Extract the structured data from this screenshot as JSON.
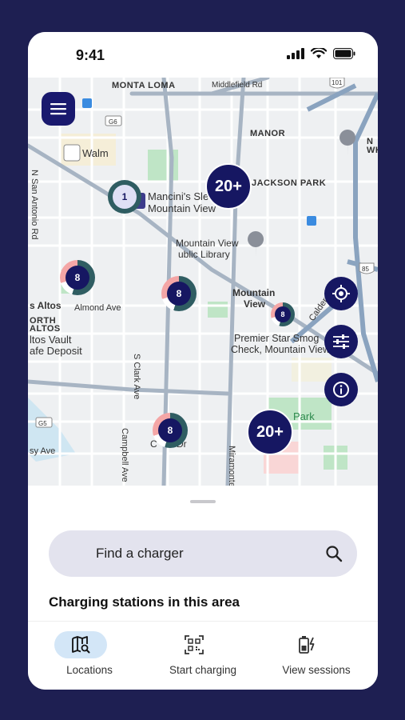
{
  "status_bar": {
    "time": "9:41"
  },
  "map": {
    "labels": {
      "monta_loma": "MONTA LOMA",
      "manor": "MANOR",
      "jackson_park": "JACKSON PARK",
      "mancini": "Mancini's Sleepworld",
      "mancini2": "Mountain View",
      "walmart": "Walm",
      "library1": "Mountain View",
      "library2": "ublic Library",
      "mv1": "Mountain",
      "mv2": "View",
      "premier1": "Premier Star Smog",
      "premier2": "Check, Mountain View",
      "los_altos": "s Altos",
      "almond": "Almond Ave",
      "orth": "ORTH",
      "altos": "ALTOS",
      "altos_vault": "ltos Vault",
      "deposit": "afe Deposit",
      "park": "Park",
      "nsanantonio": "N San Antonio Rd",
      "sclark": "S Clark Ave",
      "campbell": "Campbell Ave",
      "miramonte": "Miramonte",
      "calderon": "Calderon",
      "middlefield": "Middlefield Rd",
      "sy_ave": "sy Ave",
      "c_dr": "C",
      "dr": "Dr",
      "whi": "N",
      "whi2": "WHI",
      "g6": "G6",
      "g5": "G5",
      "r101": "101",
      "r85": "85"
    },
    "clusters": [
      {
        "label": "20+",
        "kind": "big"
      },
      {
        "label": "20+",
        "kind": "big"
      },
      {
        "label": "1",
        "kind": "ring"
      },
      {
        "label": "8",
        "kind": "ring"
      },
      {
        "label": "8",
        "kind": "ring"
      },
      {
        "label": "8",
        "kind": "ring"
      },
      {
        "label": "8",
        "kind": "ring"
      }
    ]
  },
  "sheet": {
    "search_placeholder": "Find a charger",
    "section_title": "Charging stations in this area"
  },
  "nav": {
    "items": [
      {
        "label": "Locations",
        "icon": "map-search-icon",
        "active": true
      },
      {
        "label": "Start charging",
        "icon": "qr-scan-icon",
        "active": false
      },
      {
        "label": "View sessions",
        "icon": "battery-charging-icon",
        "active": false
      }
    ]
  },
  "colors": {
    "background": "#1e1f52",
    "brand_navy": "#161762",
    "nav_active": "#d3e6f7",
    "search_bg": "#e3e3ee",
    "ring_teal": "#2f5d62",
    "ring_pink": "#f4a6a6"
  }
}
